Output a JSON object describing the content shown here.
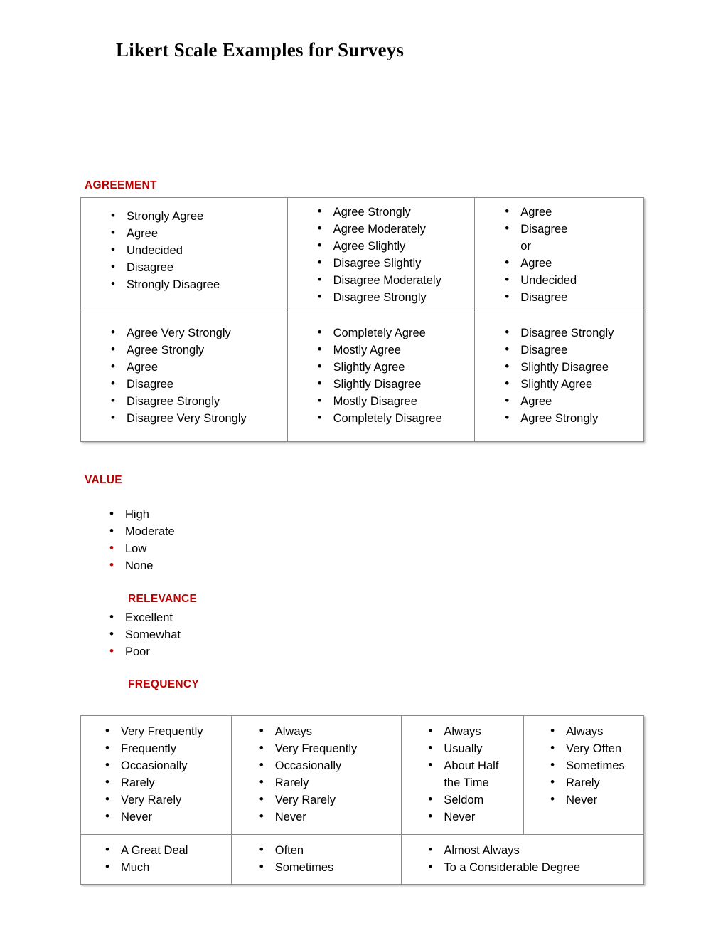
{
  "document": {
    "title": "Likert Scale Examples for Surveys"
  },
  "accent_colors": {
    "heading_red": "#C00000",
    "bullet_red": "#C00000",
    "text_black": "#000000",
    "table_border": "#8A8A8A"
  },
  "sections": {
    "agreement": {
      "heading": "AGREEMENT",
      "table": {
        "rows": [
          {
            "cells": [
              {
                "items": [
                  {
                    "text": "Strongly Agree",
                    "bullet": "black"
                  },
                  {
                    "text": "Agree",
                    "bullet": "black"
                  },
                  {
                    "text": "Undecided",
                    "bullet": "black"
                  },
                  {
                    "text": "Disagree",
                    "bullet": "black"
                  },
                  {
                    "text": "Strongly Disagree",
                    "bullet": "black"
                  }
                ]
              },
              {
                "items": [
                  {
                    "text": "Agree Strongly",
                    "bullet": "black"
                  },
                  {
                    "text": "Agree Moderately",
                    "bullet": "black"
                  },
                  {
                    "text": "Agree Slightly",
                    "bullet": "black"
                  },
                  {
                    "text": "Disagree Slightly",
                    "bullet": "black"
                  },
                  {
                    "text": "Disagree Moderately",
                    "bullet": "black"
                  },
                  {
                    "text": "Disagree Strongly",
                    "bullet": "black"
                  }
                ]
              },
              {
                "items": [
                  {
                    "text": "Agree",
                    "bullet": "black"
                  },
                  {
                    "text": "Disagree",
                    "bullet": "black"
                  },
                  {
                    "text": "or",
                    "bullet": "none"
                  },
                  {
                    "text": "Agree",
                    "bullet": "black"
                  },
                  {
                    "text": "Undecided",
                    "bullet": "black"
                  },
                  {
                    "text": "Disagree",
                    "bullet": "black"
                  }
                ]
              }
            ]
          },
          {
            "cells": [
              {
                "items": [
                  {
                    "text": "Agree Very Strongly",
                    "bullet": "black"
                  },
                  {
                    "text": "Agree Strongly",
                    "bullet": "black"
                  },
                  {
                    "text": "Agree",
                    "bullet": "black"
                  },
                  {
                    "text": "Disagree",
                    "bullet": "black"
                  },
                  {
                    "text": "Disagree Strongly",
                    "bullet": "black"
                  },
                  {
                    "text": "Disagree Very Strongly",
                    "bullet": "black"
                  }
                ]
              },
              {
                "items": [
                  {
                    "text": "Completely Agree",
                    "bullet": "black"
                  },
                  {
                    "text": "Mostly Agree",
                    "bullet": "black"
                  },
                  {
                    "text": "Slightly Agree",
                    "bullet": "black"
                  },
                  {
                    "text": "Slightly Disagree",
                    "bullet": "black"
                  },
                  {
                    "text": "Mostly Disagree",
                    "bullet": "black"
                  },
                  {
                    "text": "Completely Disagree",
                    "bullet": "black"
                  }
                ]
              },
              {
                "items": [
                  {
                    "text": "Disagree Strongly",
                    "bullet": "black"
                  },
                  {
                    "text": "Disagree",
                    "bullet": "black"
                  },
                  {
                    "text": "Slightly Disagree",
                    "bullet": "black"
                  },
                  {
                    "text": "Slightly Agree",
                    "bullet": "black"
                  },
                  {
                    "text": "Agree",
                    "bullet": "black"
                  },
                  {
                    "text": "Agree Strongly",
                    "bullet": "black"
                  }
                ]
              }
            ]
          }
        ]
      }
    },
    "value": {
      "heading": "VALUE",
      "items": [
        {
          "text": "High",
          "bullet": "black"
        },
        {
          "text": "Moderate",
          "bullet": "black"
        },
        {
          "text": "Low",
          "bullet": "red"
        },
        {
          "text": "None",
          "bullet": "red"
        }
      ]
    },
    "relevance": {
      "heading": "RELEVANCE",
      "items": [
        {
          "text": "Excellent",
          "bullet": "black"
        },
        {
          "text": "Somewhat",
          "bullet": "black"
        },
        {
          "text": "Poor",
          "bullet": "red"
        }
      ]
    },
    "frequency": {
      "heading": "FREQUENCY",
      "table": {
        "rows": [
          {
            "cells": [
              {
                "items": [
                  {
                    "text": "Very Frequently",
                    "bullet": "black"
                  },
                  {
                    "text": "Frequently",
                    "bullet": "black"
                  },
                  {
                    "text": "Occasionally",
                    "bullet": "black"
                  },
                  {
                    "text": "Rarely",
                    "bullet": "black"
                  },
                  {
                    "text": "Very Rarely",
                    "bullet": "black"
                  },
                  {
                    "text": "Never",
                    "bullet": "black"
                  }
                ]
              },
              {
                "items": [
                  {
                    "text": "Always",
                    "bullet": "black"
                  },
                  {
                    "text": "Very Frequently",
                    "bullet": "black"
                  },
                  {
                    "text": "Occasionally",
                    "bullet": "black"
                  },
                  {
                    "text": "Rarely",
                    "bullet": "black"
                  },
                  {
                    "text": "Very Rarely",
                    "bullet": "black"
                  },
                  {
                    "text": "Never",
                    "bullet": "black"
                  }
                ]
              },
              {
                "items": [
                  {
                    "text": "Always",
                    "bullet": "black"
                  },
                  {
                    "text": "Usually",
                    "bullet": "black"
                  },
                  {
                    "text": "About Half",
                    "bullet": "black"
                  },
                  {
                    "text": "the Time",
                    "bullet": "none"
                  },
                  {
                    "text": "Seldom",
                    "bullet": "black"
                  },
                  {
                    "text": "Never",
                    "bullet": "black"
                  }
                ]
              },
              {
                "items": [
                  {
                    "text": "Always",
                    "bullet": "black"
                  },
                  {
                    "text": "Very Often",
                    "bullet": "black"
                  },
                  {
                    "text": "Sometimes",
                    "bullet": "black"
                  },
                  {
                    "text": "Rarely",
                    "bullet": "black"
                  },
                  {
                    "text": "Never",
                    "bullet": "black"
                  }
                ]
              }
            ]
          },
          {
            "cells": [
              {
                "items": [
                  {
                    "text": "A Great Deal",
                    "bullet": "black"
                  },
                  {
                    "text": "Much",
                    "bullet": "black"
                  }
                ]
              },
              {
                "items": [
                  {
                    "text": "Often",
                    "bullet": "black"
                  },
                  {
                    "text": "Sometimes",
                    "bullet": "black"
                  }
                ]
              },
              {
                "colspan": 2,
                "items": [
                  {
                    "text": "Almost Always",
                    "bullet": "black"
                  },
                  {
                    "text": "To a Considerable Degree",
                    "bullet": "black"
                  }
                ]
              }
            ]
          }
        ]
      }
    }
  }
}
